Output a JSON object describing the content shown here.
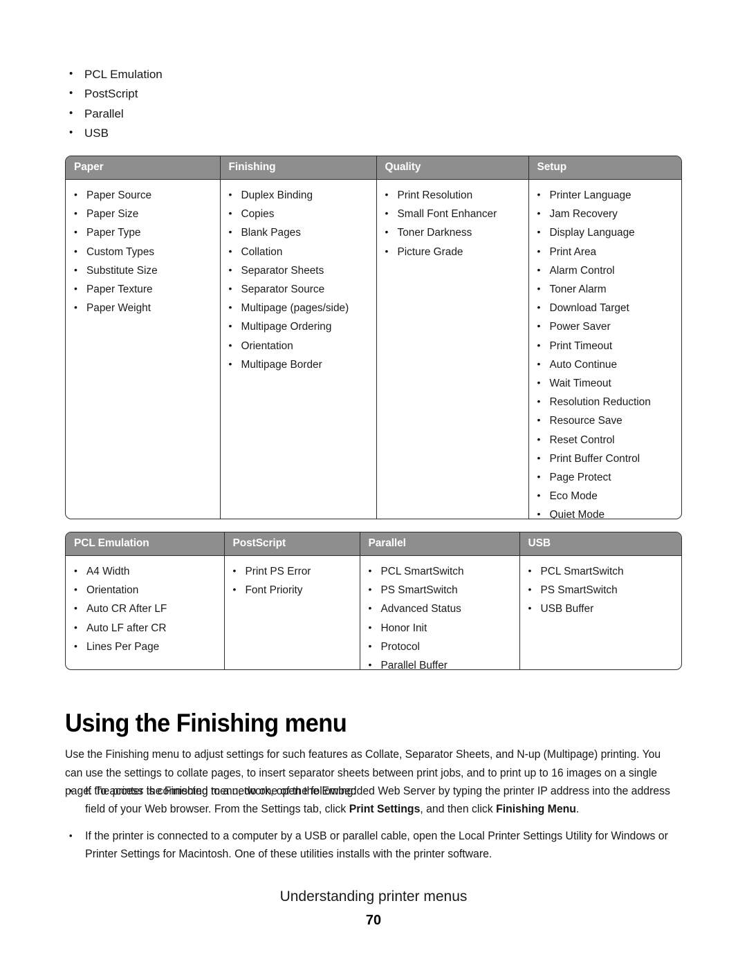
{
  "top_list": {
    "items": [
      "PCL Emulation",
      "PostScript",
      "Parallel",
      "USB"
    ]
  },
  "table_one": {
    "headers": [
      "Paper",
      "Finishing",
      "Quality",
      "Setup"
    ],
    "columns": [
      [
        "Paper Source",
        "Paper Size",
        "Paper Type",
        "Custom Types",
        "Substitute Size",
        "Paper Texture",
        "Paper Weight"
      ],
      [
        "Duplex Binding",
        "Copies",
        "Blank Pages",
        "Collation",
        "Separator Sheets",
        "Separator Source",
        "Multipage (pages/side)",
        "Multipage Ordering",
        "Orientation",
        "Multipage Border"
      ],
      [
        "Print Resolution",
        "Small Font Enhancer",
        "Toner Darkness",
        "Picture Grade"
      ],
      [
        "Printer Language",
        "Jam Recovery",
        "Display Language",
        "Print Area",
        "Alarm Control",
        "Toner Alarm",
        "Download Target",
        "Power Saver",
        "Print Timeout",
        "Auto Continue",
        "Wait Timeout",
        "Resolution Reduction",
        "Resource Save",
        "Reset Control",
        "Print Buffer Control",
        "Page Protect",
        "Eco Mode",
        "Quiet Mode"
      ]
    ]
  },
  "table_two": {
    "headers": [
      "PCL Emulation",
      "PostScript",
      "Parallel",
      "USB"
    ],
    "columns": [
      [
        "A4 Width",
        "Orientation",
        "Auto CR After LF",
        "Auto LF after CR",
        "Lines Per Page"
      ],
      [
        "Print PS Error",
        "Font Priority"
      ],
      [
        "PCL SmartSwitch",
        "PS SmartSwitch",
        "Advanced Status",
        "Honor Init",
        "Protocol",
        "Parallel Buffer"
      ],
      [
        "PCL SmartSwitch",
        "PS SmartSwitch",
        "USB Buffer"
      ]
    ]
  },
  "section": {
    "heading": "Using the Finishing menu",
    "paragraph": "Use the Finishing menu to adjust settings for such features as Collate, Separator Sheets, and N-up (Multipage) printing. You can use the settings to collate pages, to insert separator sheets between print jobs, and to print up to 16 images on a single page. To access the Finishing menu, do one of the following:",
    "bullets": [
      {
        "parts": [
          {
            "text": "If the printer is connected to a network, open the Embedded Web Server by typing the printer IP address into the address field of your Web browser. From the Settings tab, click ",
            "bold": false
          },
          {
            "text": "Print Settings",
            "bold": true
          },
          {
            "text": ", and then click ",
            "bold": false
          },
          {
            "text": "Finishing Menu",
            "bold": true
          },
          {
            "text": ".",
            "bold": false
          }
        ]
      },
      {
        "parts": [
          {
            "text": "If the printer is connected to a computer by a USB or parallel cable, open the Local Printer Settings Utility for Windows or Printer Settings for Macintosh. One of these utilities installs with the printer software.",
            "bold": false
          }
        ]
      }
    ]
  },
  "footer": {
    "title": "Understanding printer menus",
    "page_number": "70"
  },
  "colors": {
    "header_gray": "#8e8e8e",
    "border": "#2c2c2c",
    "text": "#161616",
    "page_background": "#ffffff"
  }
}
